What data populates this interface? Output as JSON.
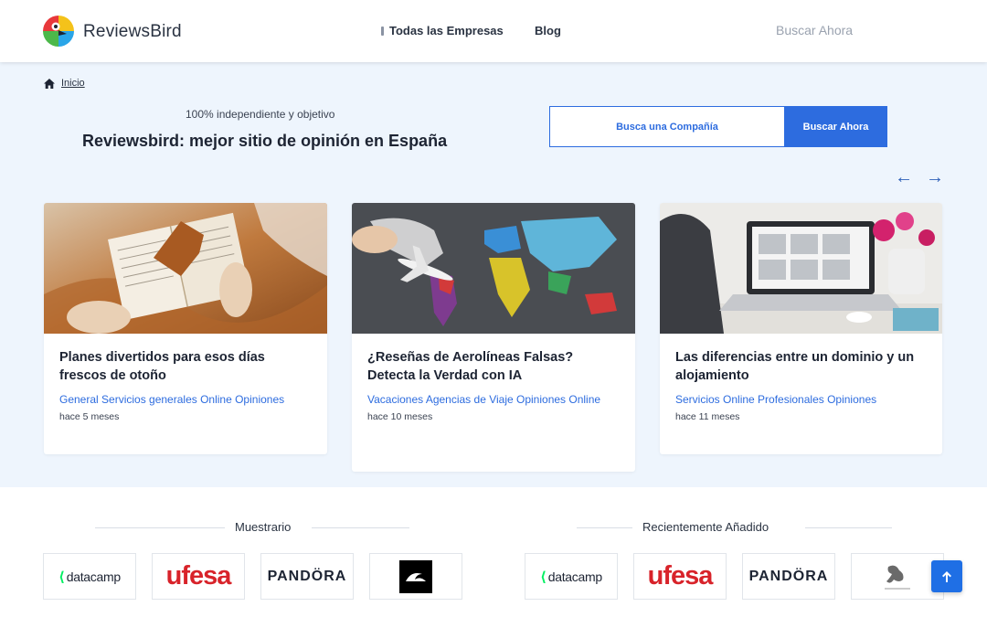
{
  "header": {
    "brand": "ReviewsBird",
    "nav": {
      "all_companies": "Todas las Empresas",
      "blog": "Blog"
    },
    "search_link": "Buscar Ahora"
  },
  "breadcrumb": {
    "home": "Inicio"
  },
  "hero": {
    "tagline": "100% independiente y objetivo",
    "headline": "Reviewsbird: mejor sitio de opinión en España",
    "search_box": "Busca una Compañía",
    "search_button": "Buscar Ahora",
    "prev_arrow": "←",
    "next_arrow": "→"
  },
  "cards": [
    {
      "title": "Planes divertidos para esos días frescos de otoño",
      "categories": "General Servicios generales Online Opiniones",
      "time": "hace 5 meses",
      "image_subject": "open-book-autumn-leaf"
    },
    {
      "title": "¿Reseñas de Aerolíneas Falsas? Detecta la Verdad con IA",
      "categories": "Vacaciones Agencias de Viaje Opiniones Online",
      "time": "hace 10 meses",
      "image_subject": "world-map-toy-airplane"
    },
    {
      "title": "Las diferencias entre un dominio y un alojamiento",
      "categories": "Servicios Online Profesionales Opiniones",
      "time": "hace 11 meses",
      "image_subject": "laptop-workspace-flowers"
    }
  ],
  "showcase": {
    "title": "Muestrario",
    "logos": [
      {
        "text": "datacamp"
      },
      {
        "text": "ufesa"
      },
      {
        "text": "PANDÖRA"
      },
      {
        "icon": "quiksilver-logo"
      }
    ]
  },
  "recent": {
    "title": "Recientemente Añadido",
    "logos": [
      {
        "text": "datacamp"
      },
      {
        "text": "ufesa"
      },
      {
        "text": "PANDÖRA"
      },
      {
        "icon": "lizard-logo"
      }
    ]
  },
  "colors": {
    "accent": "#2d6cdf",
    "hero_bg": "#eef5fd",
    "text": "#1d2433",
    "ufesa_red": "#d8232a",
    "datacamp_green": "#03ef62"
  },
  "icons": {
    "home": "home-icon",
    "scroll_top": "arrow-up-icon"
  }
}
